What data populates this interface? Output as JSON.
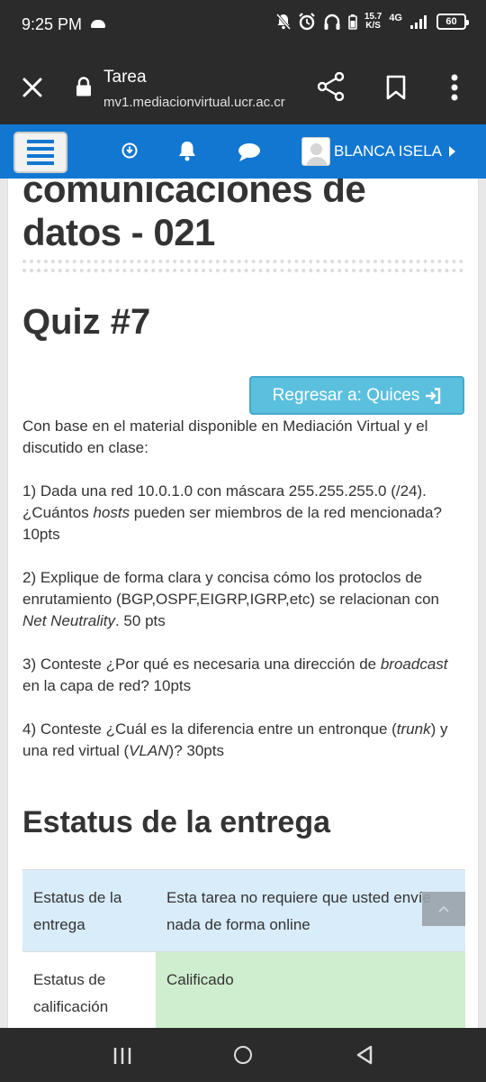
{
  "status_bar": {
    "time": "9:25 PM",
    "speed_value": "15.7",
    "speed_unit": "K/S",
    "network": "4G",
    "battery": "60"
  },
  "browser": {
    "title": "Tarea",
    "url": "mv1.mediacionvirtual.ucr.ac.cr"
  },
  "navbar": {
    "user_name": "BLANCA ISELA"
  },
  "course": {
    "title_line1": "comunicaciones de",
    "title_line2": "datos - 021"
  },
  "quiz": {
    "title": "Quiz #7",
    "back_button": "Regresar a: Quices",
    "intro": "Con base en el material disponible en Mediación Virtual y el discutido en clase:",
    "q1": {
      "before": "1) Dada una red 10.0.1.0 con máscara 255.255.255.0 (/24). ¿Cuántos ",
      "em": "hosts",
      "after": " pueden ser miembros de la red mencionada? 10pts"
    },
    "q2": {
      "before": "2) Explique de forma clara y concisa cómo los protoclos de enrutamiento (BGP,OSPF,EIGRP,IGRP,etc) se relacionan con ",
      "em": "Net Neutrality",
      "after": ". 50 pts"
    },
    "q3": {
      "before": "3) Conteste ¿Por qué es necesaria una dirección de ",
      "em": "broadcast",
      "after": " en la capa de red? 10pts"
    },
    "q4": {
      "before": "4) Conteste ¿Cuál es la diferencia entre un entronque (",
      "em1": "trunk",
      "middle": ") y una red virtual (",
      "em2": "VLAN",
      "after": ")? 30pts"
    }
  },
  "submission": {
    "heading": "Estatus de la entrega",
    "rows": [
      {
        "label": "Estatus de la entrega",
        "value": "Esta tarea no requiere que usted envíe nada de forma online"
      },
      {
        "label": "Estatus de calificación",
        "value": "Calificado"
      }
    ]
  },
  "colors": {
    "navbar": "#1177d1",
    "button_info": "#5bc0de",
    "row_blue": "#d8ecfa",
    "row_green": "#cfeecf"
  }
}
